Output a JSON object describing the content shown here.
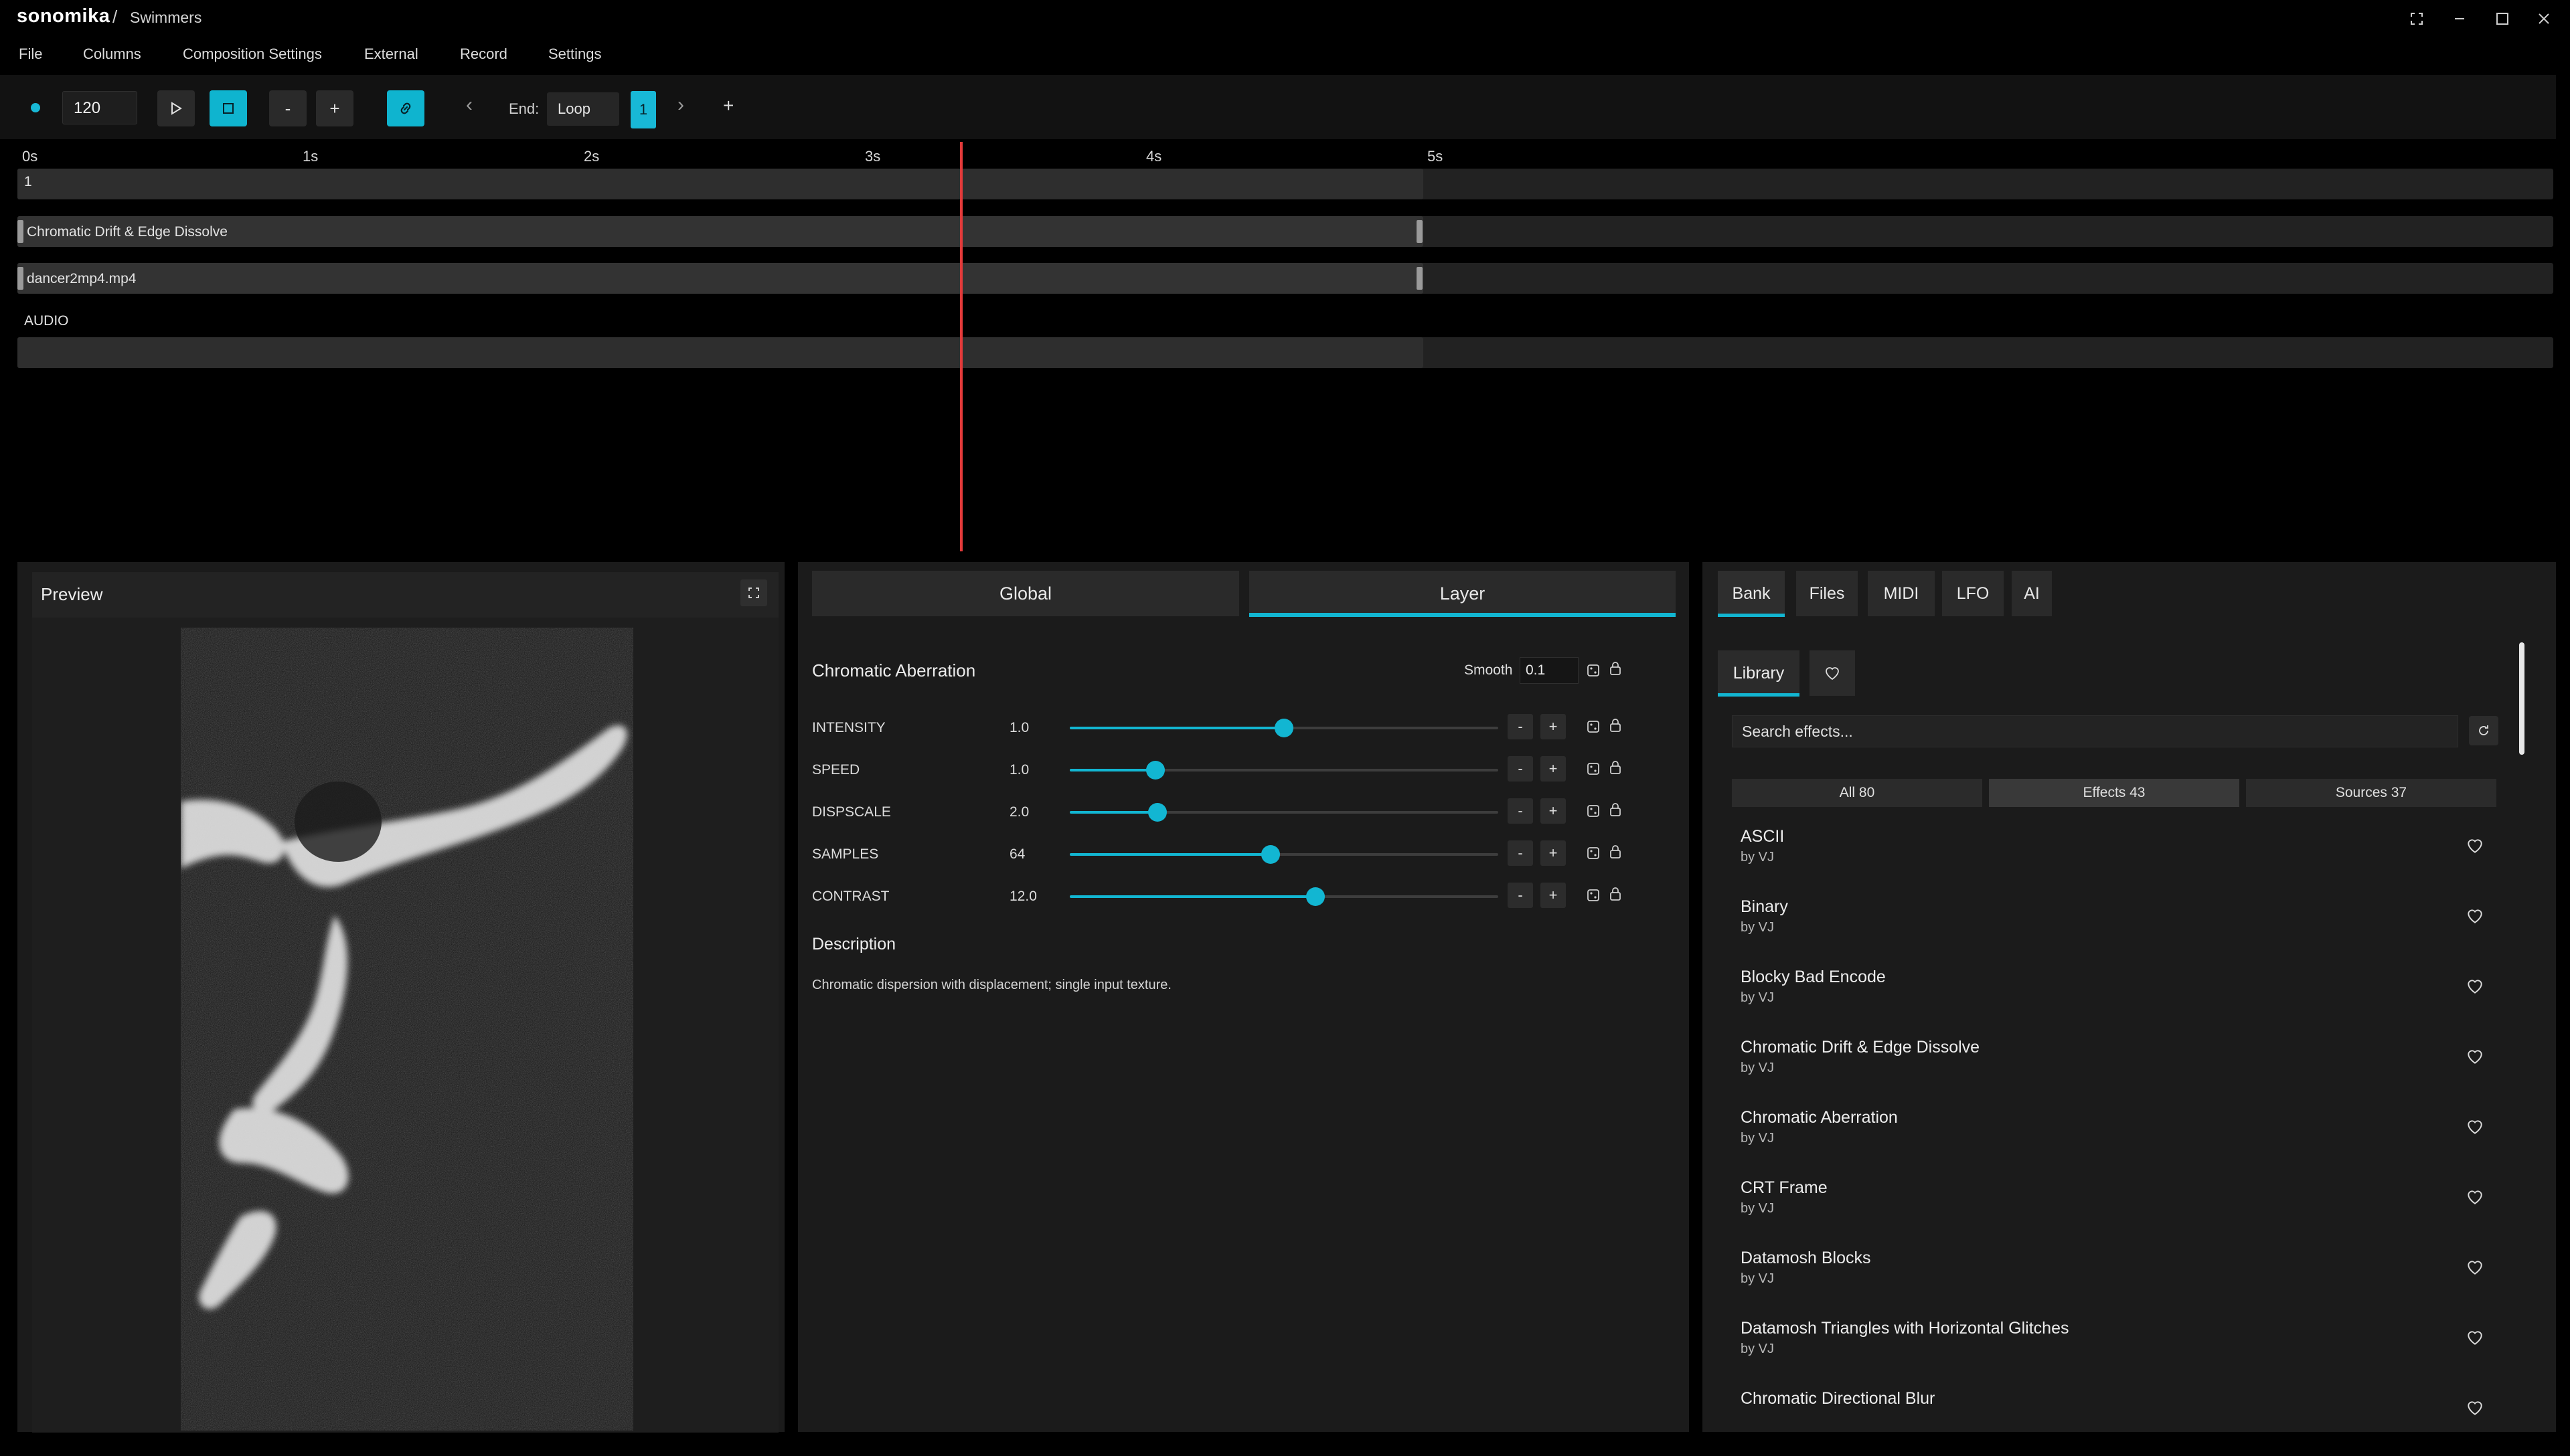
{
  "app": {
    "logo": "sonomika",
    "separator": "/",
    "title": "Swimmers"
  },
  "window_controls": [
    "fullscreen-icon",
    "minimize-icon",
    "maximize-icon",
    "close-icon"
  ],
  "menu": [
    "File",
    "Columns",
    "Composition Settings",
    "External",
    "Record",
    "Settings"
  ],
  "transport": {
    "bpm": "120",
    "minus": "-",
    "plus": "+",
    "end_label": "End:",
    "end_mode": "Loop",
    "end_count": "1",
    "add": "+"
  },
  "timeline": {
    "ticks": [
      "0s",
      "1s",
      "2s",
      "3s",
      "4s",
      "5s"
    ],
    "tracks": [
      {
        "label": "1"
      },
      {
        "label": "Chromatic Drift & Edge Dissolve"
      },
      {
        "label": "dancer2mp4.mp4"
      },
      {
        "label": "AUDIO"
      }
    ]
  },
  "preview": {
    "title": "Preview"
  },
  "center": {
    "tabs": [
      "Global",
      "Layer"
    ],
    "active_tab": "Layer",
    "effect_name": "Chromatic Aberration",
    "smooth_label": "Smooth",
    "smooth_value": "0.1",
    "params": [
      {
        "name": "INTENSITY",
        "value": "1.0",
        "fraction": 0.5
      },
      {
        "name": "SPEED",
        "value": "1.0",
        "fraction": 0.2
      },
      {
        "name": "DISPSCALE",
        "value": "2.0",
        "fraction": 0.205
      },
      {
        "name": "SAMPLES",
        "value": "64",
        "fraction": 0.468
      },
      {
        "name": "CONTRAST",
        "value": "12.0",
        "fraction": 0.574
      }
    ],
    "minus": "-",
    "plus": "+",
    "description_title": "Description",
    "description_text": "Chromatic dispersion with displacement; single input texture."
  },
  "right": {
    "tabs": [
      "Bank",
      "Files",
      "MIDI",
      "LFO",
      "AI"
    ],
    "active_tab": "Bank",
    "library_tab": "Library",
    "search_placeholder": "Search effects...",
    "filters": [
      "All 80",
      "Effects 43",
      "Sources 37"
    ],
    "active_filter": "Effects 43",
    "items": [
      {
        "title": "ASCII",
        "author": "by VJ"
      },
      {
        "title": "Binary",
        "author": "by VJ"
      },
      {
        "title": "Blocky Bad Encode",
        "author": "by VJ"
      },
      {
        "title": "Chromatic Drift & Edge Dissolve",
        "author": "by VJ"
      },
      {
        "title": "Chromatic Aberration",
        "author": "by VJ"
      },
      {
        "title": "CRT Frame",
        "author": "by VJ"
      },
      {
        "title": "Datamosh Blocks",
        "author": "by VJ"
      },
      {
        "title": "Datamosh Triangles with Horizontal Glitches",
        "author": "by VJ"
      },
      {
        "title": "Chromatic Directional Blur",
        "author": ""
      }
    ]
  },
  "colors": {
    "accent": "#12b6d2",
    "playhead": "#e23a3a",
    "background": "#000000",
    "panel": "#1b1b1b"
  }
}
